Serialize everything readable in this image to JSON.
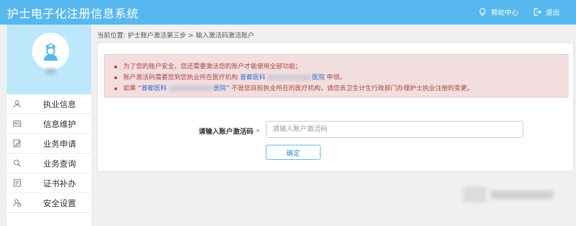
{
  "app": {
    "title": "护士电子化注册信息系统"
  },
  "header": {
    "help": {
      "label": "帮助中心",
      "icon": "lightbulb-icon"
    },
    "exit": {
      "label": "退出",
      "icon": "logout-icon"
    }
  },
  "colors": {
    "topbar": "#57b8ef",
    "profile_bg": "#bde8fb",
    "alert_text": "#a94442",
    "alert_bg": "#f2dede",
    "link": "#2a6bd0",
    "required": "#d9534f"
  },
  "sidebar": {
    "avatar_icon": "nurse-avatar-icon",
    "items": [
      {
        "label": "执业信息",
        "icon": "user-badge-icon"
      },
      {
        "label": "信息维护",
        "icon": "id-card-icon"
      },
      {
        "label": "业务申请",
        "icon": "edit-form-icon"
      },
      {
        "label": "业务查询",
        "icon": "query-icon"
      },
      {
        "label": "证书补办",
        "icon": "certificate-icon"
      },
      {
        "label": "安全设置",
        "icon": "user-lock-icon"
      }
    ]
  },
  "breadcrumb": {
    "text": "当前位置: 护士账户激活第三步 > 输入激活码激活账户"
  },
  "alert": {
    "line1": "为了您的账户安全，您还需要激活您的账户才能使用全部功能；",
    "line2_before": "账户激活码需要您到您执业所在医疗机构 ",
    "line2_hosp_start": "首都医科",
    "line2_hosp_end": "医院",
    "line2_after": " 申领。",
    "line3_before": "如果 “",
    "line3_hosp_start": "首都医科",
    "line3_hosp_end": "医院”",
    "line3_after": " 不是您目前执业所在的医疗机构，请您去卫生计生行政部门办理护士执业注册的变更。"
  },
  "form": {
    "label": "请输入账户激活码",
    "required_mark": "*",
    "placeholder": "请输入账户激活码",
    "value": "",
    "submit_label": "确定"
  }
}
